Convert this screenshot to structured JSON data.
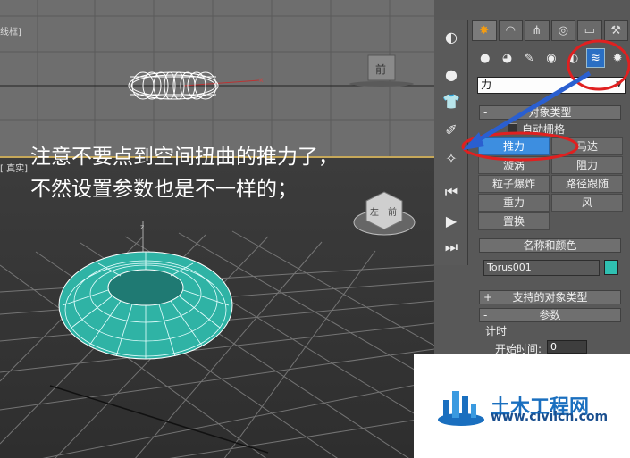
{
  "viewports": {
    "top_label": "线框]",
    "persp_label": "[ 真实]",
    "top_cube": "前",
    "persp_cube_left": "左",
    "persp_cube_front": "前"
  },
  "annotation": {
    "line1": "注意不要点到空间扭曲的推力了，",
    "line2": "不然设置参数也是不一样的；"
  },
  "tabs": [
    {
      "icon": "create-icon",
      "glyph": "✸",
      "active": true
    },
    {
      "icon": "modify-icon",
      "glyph": "◠"
    },
    {
      "icon": "hierarchy-icon",
      "glyph": "⋔"
    },
    {
      "icon": "motion-icon",
      "glyph": "◎"
    },
    {
      "icon": "display-icon",
      "glyph": "▭"
    },
    {
      "icon": "utilities-icon",
      "glyph": "⚒"
    }
  ],
  "subicons": [
    {
      "icon": "geometry-icon",
      "glyph": "●"
    },
    {
      "icon": "shapes-icon",
      "glyph": "◕"
    },
    {
      "icon": "lights-icon",
      "glyph": "✎"
    },
    {
      "icon": "cameras-icon",
      "glyph": "◉"
    },
    {
      "icon": "helpers-icon",
      "glyph": "◐"
    },
    {
      "icon": "spacewarps-icon",
      "glyph": "≋",
      "active": true
    },
    {
      "icon": "systems-icon",
      "glyph": "✹"
    }
  ],
  "dropdown": {
    "value": "力"
  },
  "object_type": {
    "header": "对象类型",
    "autogrid": "自动栅格",
    "buttons": [
      "推力",
      "马达",
      "漩涡",
      "阻力",
      "粒子爆炸",
      "路径跟随",
      "重力",
      "风",
      "置换"
    ],
    "selected_index": 0
  },
  "name_color": {
    "header": "名称和颜色",
    "name": "Torus001",
    "swatch_color": "#2fc0b1"
  },
  "supported": {
    "header": "支持的对象类型"
  },
  "params": {
    "header": "参数",
    "timing": "计时",
    "start_label": "开始时间:",
    "start_value": "0"
  },
  "watermark": {
    "title": "土木工程网",
    "url": "www.civilcn.com"
  },
  "colors": {
    "accent": "#3d8ee0",
    "highlight_circle": "#e02020",
    "arrow": "#2a5fd0"
  }
}
